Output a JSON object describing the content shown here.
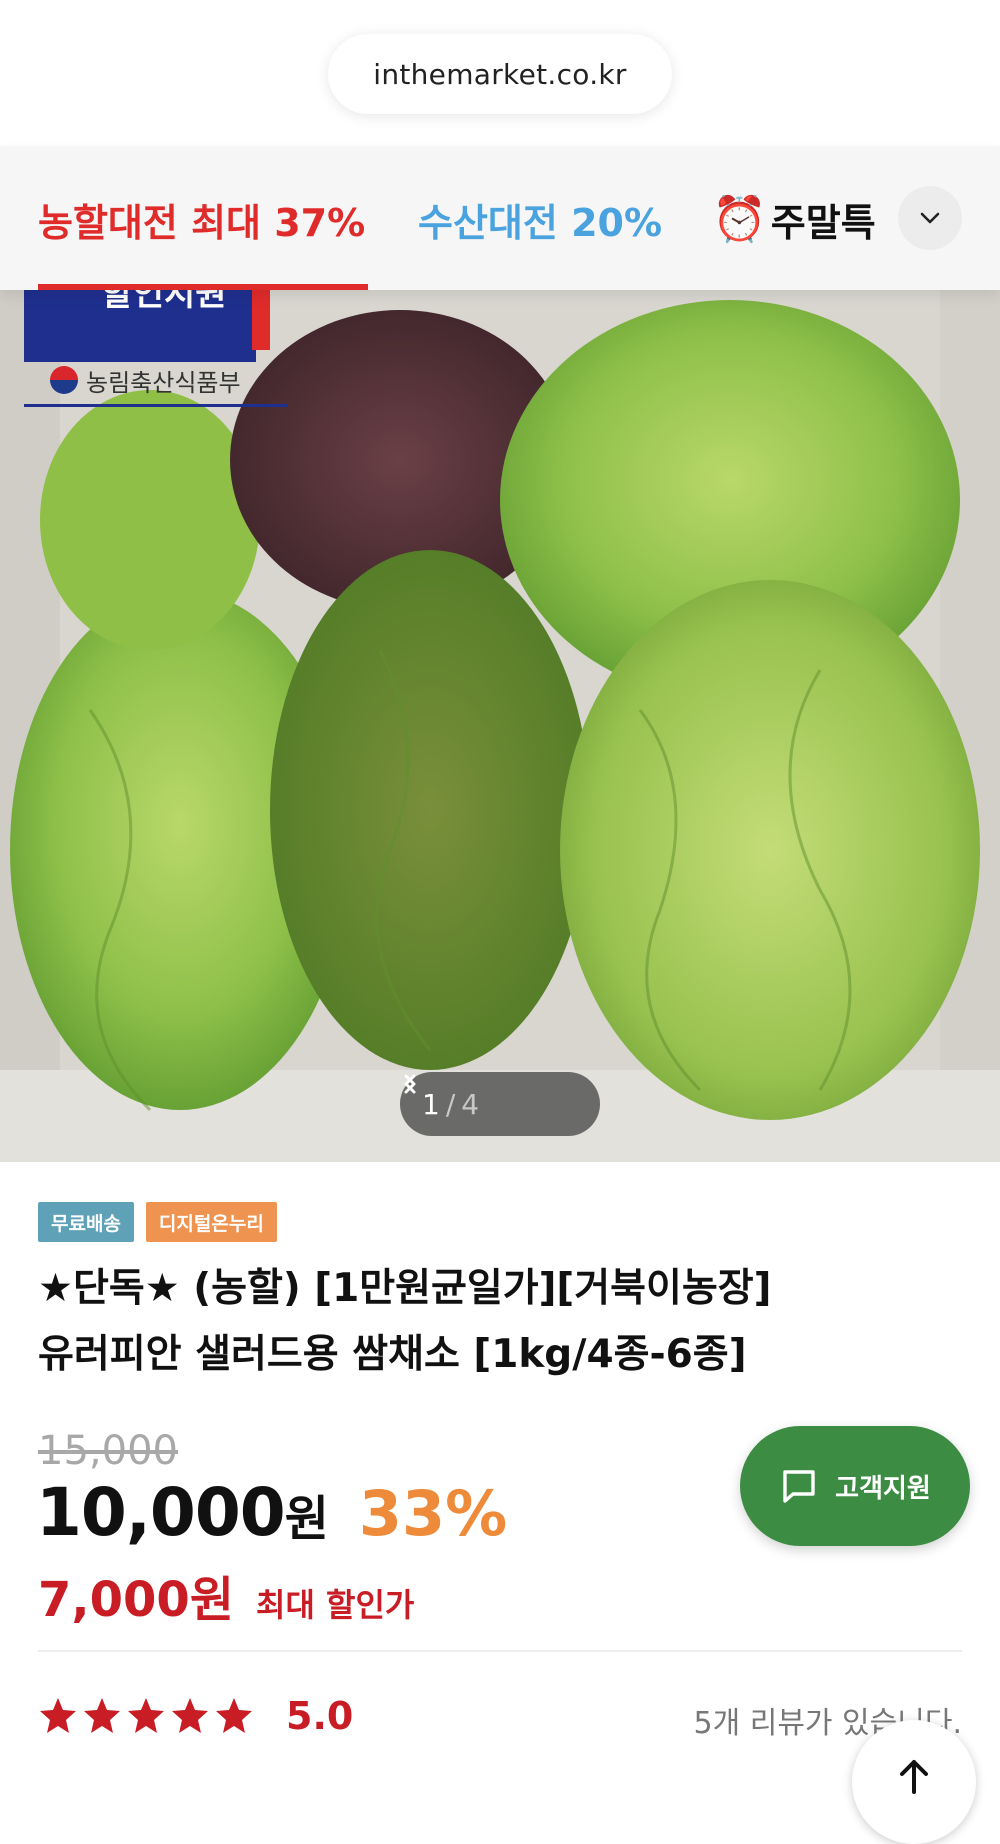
{
  "browser": {
    "url": "inthemarket.co.kr"
  },
  "category_nav": {
    "items": [
      {
        "label": "농할대전 최대 37%",
        "color": "#e02b2b"
      },
      {
        "label": "수산대전 20%",
        "color": "#4aa3de"
      },
      {
        "label": "주말특",
        "icon": "alarm-clock-icon",
        "color": "#111111"
      }
    ],
    "expand_icon": "chevron-down-icon"
  },
  "hero": {
    "badge_text": "할인지원",
    "ministry_label": "농림축산식품부",
    "pager": {
      "current": "1",
      "separator": "/",
      "total": "4"
    }
  },
  "product": {
    "tags": [
      "무료배송",
      "디지털온누리"
    ],
    "title_line1": "★단독★ (농할) [1만원균일가][거북이농장]",
    "title_line2": "유러피안 샐러드용 쌈채소 [1kg/4종-6종]",
    "original_price": "15,000",
    "price": "10,000",
    "price_unit": "원",
    "discount": "33%",
    "max_price": "7,000원",
    "max_label": "최대 할인가",
    "rating": "5.0",
    "stars": 5,
    "review_text": "5개 리뷰가 있습니다."
  },
  "support_button": {
    "label": "고객지원",
    "icon": "chat-bubble-icon"
  },
  "scroll_top_icon": "arrow-up-icon",
  "colors": {
    "accent_red": "#c81d25",
    "discount_orange": "#ee8b3a",
    "support_green": "#3c8d43",
    "tag_blue": "#5fa2b8",
    "tag_orange": "#ee9350"
  }
}
